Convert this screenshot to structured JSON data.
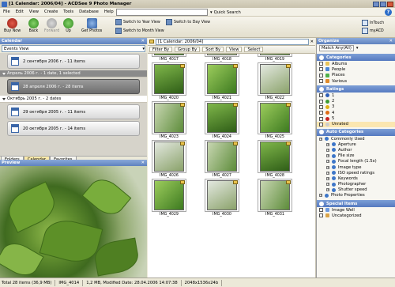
{
  "window": {
    "title": "[1 Calendar: 2006/04] - ACDSee 9 Photo Manager"
  },
  "menu": [
    "File",
    "Edit",
    "View",
    "Create",
    "Tools",
    "Database",
    "Help"
  ],
  "quick_search": "Quick Search",
  "toolbar": {
    "buy_now": "Buy Now",
    "back": "Back",
    "forward": "Forward",
    "up": "Up",
    "get_photos": "Get Photos",
    "year_view": "Switch to Year View",
    "day_view": "Switch to Day View",
    "month_view": "Switch to Month View",
    "intouch": "InTouch",
    "myacd": "myACD"
  },
  "calendar": {
    "title": "Calendar",
    "events_view": "Events View",
    "groups": [
      {
        "label": "Апрель 2006 г. - 1 date, 1 selected",
        "cards": [
          {
            "label": "28 апреля 2006 г. - 28 items"
          }
        ]
      },
      {
        "label": "Октябрь 2005 г. - 2 dates",
        "cards": [
          {
            "label": "29 октября 2005 г. - 11 items"
          },
          {
            "label": "20 октября 2005 г. - 14 items"
          }
        ]
      }
    ],
    "top_card": "2 сентября 2006 г. - 11 items"
  },
  "tabs": [
    "Folders",
    "Calendar",
    "Favorites"
  ],
  "preview": {
    "title": "Preview"
  },
  "browser": {
    "address": "[1 Calendar: 2006/04]",
    "toolbar": [
      "Filter By",
      "Group By",
      "Sort By",
      "View",
      "Select"
    ],
    "thumbs": [
      "IMG_4017",
      "IMG_4018",
      "IMG_4019",
      "IMG_4020",
      "IMG_4021",
      "IMG_4022",
      "IMG_4023",
      "IMG_4024",
      "IMG_4025",
      "IMG_4026",
      "IMG_4027",
      "IMG_4028",
      "IMG_4029",
      "IMG_4030",
      "IMG_4031"
    ]
  },
  "organize": {
    "title": "Organize",
    "match": "Match Any(All)",
    "categories_title": "Categories",
    "categories": [
      "Albums",
      "People",
      "Places",
      "Various"
    ],
    "ratings_title": "Ratings",
    "ratings": [
      "1",
      "2",
      "3",
      "4",
      "5",
      "Unrated"
    ],
    "rating_colors": [
      "#2f5fb8",
      "#3f9b34",
      "#e0b21a",
      "#e06d16",
      "#c92424",
      "#cccccc"
    ],
    "auto_title": "Auto Categories",
    "auto": [
      "Commonly Used",
      "Aperture",
      "Author",
      "File size",
      "Focal length (1.5x)",
      "Image type",
      "ISO speed ratings",
      "Keywords",
      "Photographer",
      "Shutter speed",
      "Photo Properties"
    ],
    "special_title": "Special Items",
    "special": [
      "Image Well",
      "Uncategorized"
    ]
  },
  "status": {
    "total": "Total 28 items (36,9 MB)",
    "file": "IMG_4014",
    "info": "1,2 MB, Modified Date: 28.04.2006 14:07:38",
    "dims": "2048x1536x24b"
  }
}
